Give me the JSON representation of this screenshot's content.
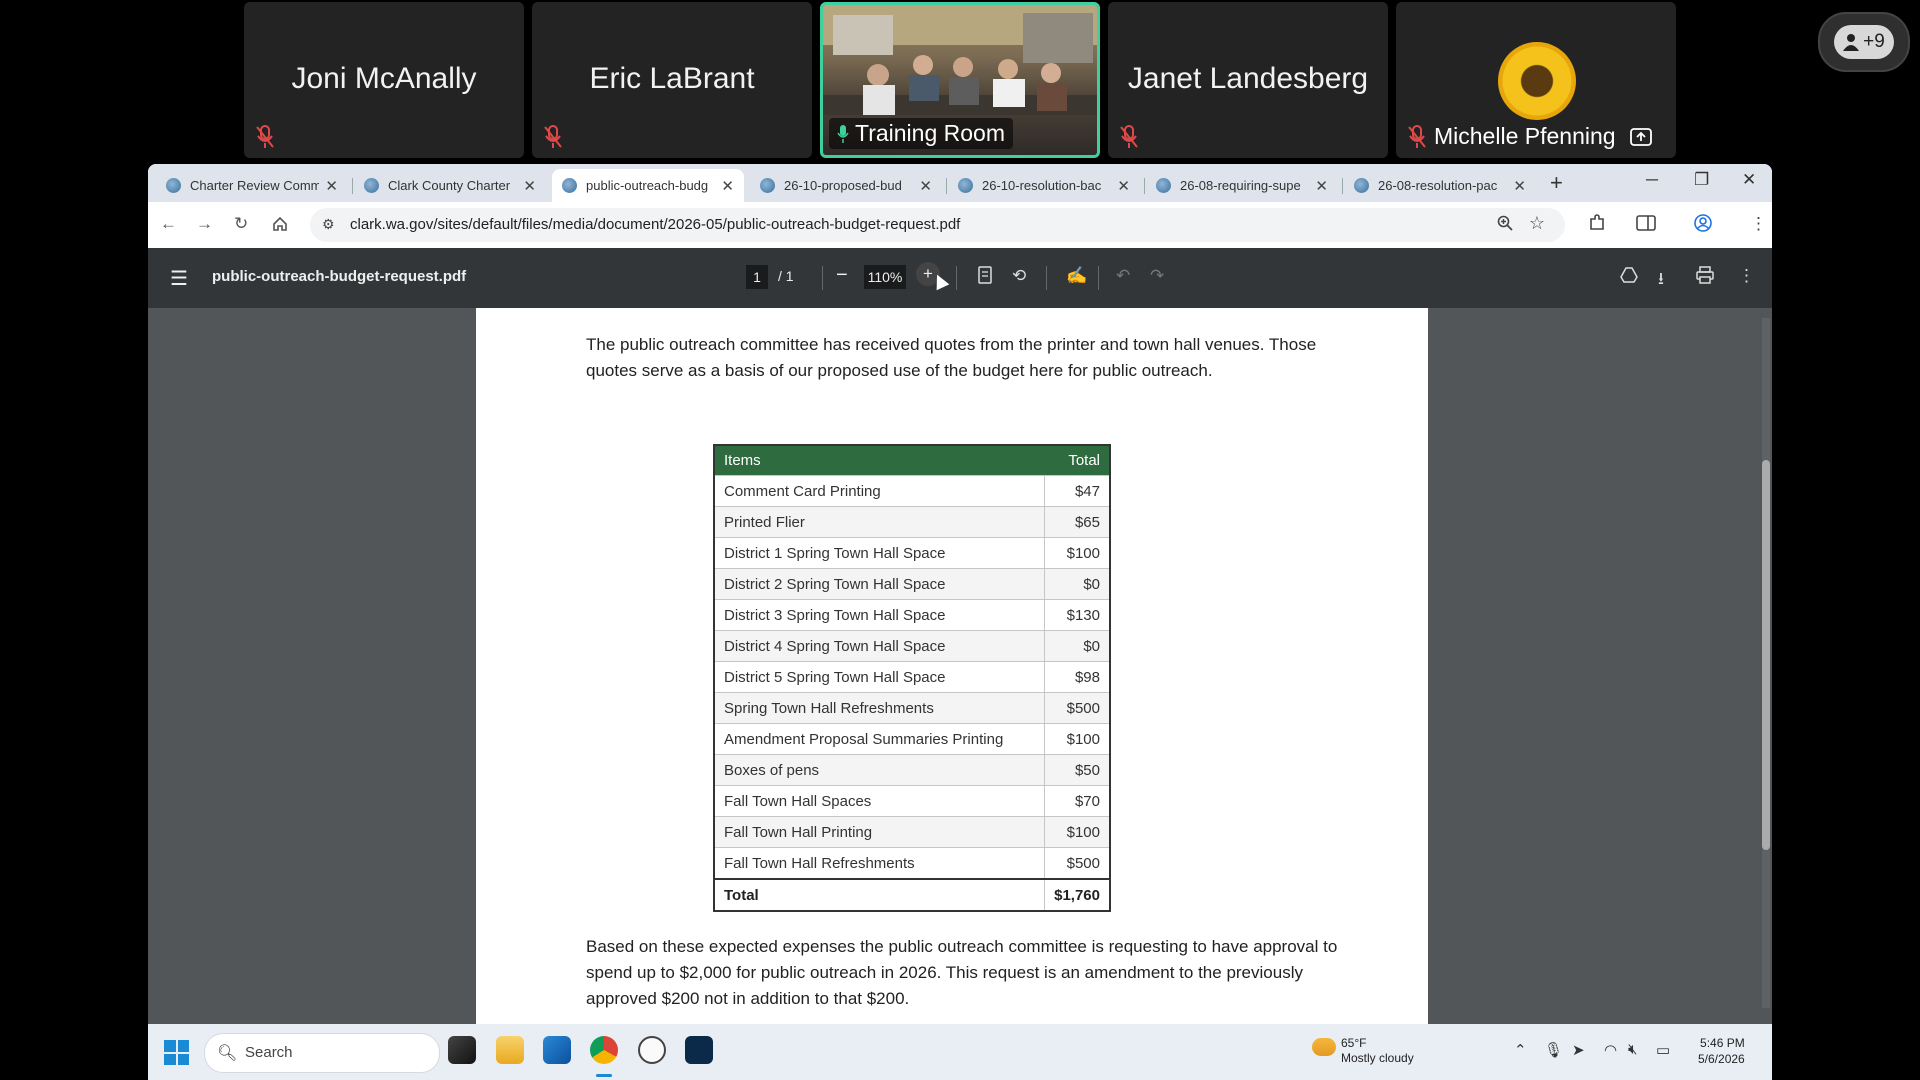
{
  "meeting": {
    "participants": [
      {
        "name": "Joni McAnally",
        "muted": true
      },
      {
        "name": "Eric LaBrant",
        "muted": true
      },
      {
        "name": "Training Room",
        "video": true,
        "speaking": true
      },
      {
        "name": "Janet Landesberg",
        "muted": true
      },
      {
        "name": "Michelle Pfenning",
        "muted": true,
        "sharing": true
      }
    ],
    "more_count": "+9"
  },
  "browser": {
    "tabs": [
      {
        "label": "Charter Review Comm",
        "active": false
      },
      {
        "label": "Clark County Charter",
        "active": false
      },
      {
        "label": "public-outreach-budg",
        "active": true
      },
      {
        "label": "26-10-proposed-bud",
        "active": false
      },
      {
        "label": "26-10-resolution-bac",
        "active": false
      },
      {
        "label": "26-08-requiring-supe",
        "active": false
      },
      {
        "label": "26-08-resolution-pac",
        "active": false
      }
    ],
    "new_tab": "+",
    "url": "clark.wa.gov/sites/default/files/media/document/2026-05/public-outreach-budget-request.pdf"
  },
  "pdf": {
    "file_name": "public-outreach-budget-request.pdf",
    "page_current": "1",
    "page_total": "1",
    "zoom": "110%",
    "intro_text": "The public outreach committee has received quotes from the printer and town hall venues. Those quotes serve as a basis of our proposed use of the budget here for public outreach.",
    "table": {
      "headers": [
        "Items",
        "Total"
      ],
      "rows": [
        [
          "Comment Card Printing",
          "$47"
        ],
        [
          "Printed Flier",
          "$65"
        ],
        [
          "District 1 Spring Town Hall Space",
          "$100"
        ],
        [
          "District 2 Spring Town Hall Space",
          "$0"
        ],
        [
          "District 3 Spring Town Hall Space",
          "$130"
        ],
        [
          "District 4 Spring Town Hall Space",
          "$0"
        ],
        [
          "District 5 Spring Town Hall Space",
          "$98"
        ],
        [
          "Spring Town Hall Refreshments",
          "$500"
        ],
        [
          "Amendment Proposal Summaries Printing",
          "$100"
        ],
        [
          "Boxes of pens",
          "$50"
        ],
        [
          "Fall Town Hall Spaces",
          "$70"
        ],
        [
          "Fall Town Hall Printing",
          "$100"
        ],
        [
          "Fall Town Hall Refreshments",
          "$500"
        ]
      ],
      "total_label": "Total",
      "total_value": "$1,760"
    },
    "closing_text": "Based on these expected expenses the public outreach committee is requesting to have approval to spend up to $2,000 for public outreach in 2026. This request is an amendment to the previously approved $200 not in addition to that $200."
  },
  "taskbar": {
    "search_placeholder": "Search",
    "weather_temp": "65°F",
    "weather_desc": "Mostly cloudy",
    "time": "5:46 PM",
    "date": "5/6/2026"
  },
  "colors": {
    "table_header": "#2e6b3f",
    "speaking_border": "#3fd0a0",
    "pdf_toolbar": "#333639",
    "viewer_bg": "#525659"
  }
}
